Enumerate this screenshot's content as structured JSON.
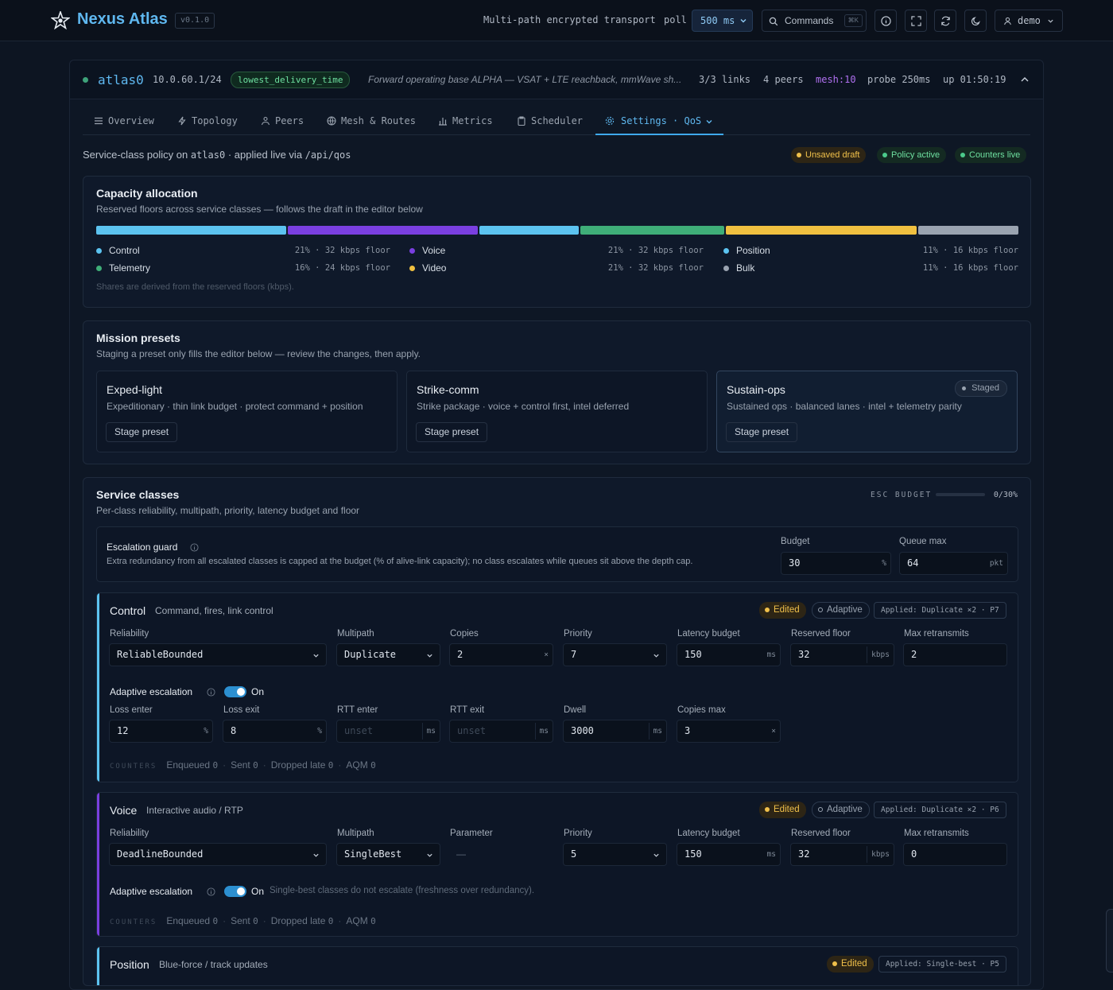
{
  "app": {
    "name": "Nexus Atlas",
    "version": "v0.1.0",
    "tagline": "Multi-path encrypted transport",
    "poll_label": "poll",
    "poll_value": "500 ms",
    "commands_label": "Commands",
    "commands_kbd": "⌘K",
    "user": "demo"
  },
  "iface": {
    "name": "atlas0",
    "address": "10.0.60.1/24",
    "mode": "lowest_delivery_time",
    "description": "Forward operating base ALPHA — VSAT + LTE reachback, mmWave sh...",
    "links": "3/3 links",
    "peers": "4 peers",
    "mesh": "mesh:10",
    "probe": "probe 250ms",
    "uptime": "up 01:50:19"
  },
  "tabs": [
    {
      "label": "Overview"
    },
    {
      "label": "Topology"
    },
    {
      "label": "Peers"
    },
    {
      "label": "Mesh & Routes"
    },
    {
      "label": "Metrics"
    },
    {
      "label": "Scheduler"
    },
    {
      "label": "Settings · QoS"
    }
  ],
  "policy": {
    "prefix": "Service-class policy on",
    "iface": "atlas0",
    "mid": "· applied live via",
    "endpoint": "/api/qos"
  },
  "status_chips": [
    {
      "label": "Unsaved draft",
      "color": "#f0c04a"
    },
    {
      "label": "Policy active",
      "color": "#4bc98a"
    },
    {
      "label": "Counters live",
      "color": "#4bc98a"
    }
  ],
  "capacity": {
    "title": "Capacity allocation",
    "subtitle": "Reserved floors across service classes — follows the draft in the editor below",
    "note": "Shares are derived from the reserved floors (kbps).",
    "classes": [
      {
        "name": "Control",
        "share": 21,
        "value": "21% · 32 kbps floor",
        "color": "#5cc3f0"
      },
      {
        "name": "Voice",
        "share": 21,
        "value": "21% · 32 kbps floor",
        "color": "#7a3fe0"
      },
      {
        "name": "Position",
        "share": 11,
        "value": "11% · 16 kbps floor",
        "color": "#5cc3f0"
      },
      {
        "name": "Telemetry",
        "share": 16,
        "value": "16% · 24 kbps floor",
        "color": "#3fae78"
      },
      {
        "name": "Video",
        "share": 21,
        "value": "21% · 32 kbps floor",
        "color": "#f0c040"
      },
      {
        "name": "Bulk",
        "share": 11,
        "value": "11% · 16 kbps floor",
        "color": "#9aa3b0"
      }
    ]
  },
  "presets": {
    "title": "Mission presets",
    "subtitle": "Staging a preset only fills the editor below — review the changes, then apply.",
    "button_label": "Stage preset",
    "staged_label": "Staged",
    "items": [
      {
        "name": "Exped-light",
        "desc": "Expeditionary · thin link budget · protect command + position"
      },
      {
        "name": "Strike-comm",
        "desc": "Strike package · voice + control first, intel deferred"
      },
      {
        "name": "Sustain-ops",
        "desc": "Sustained ops · balanced lanes · intel + telemetry parity"
      }
    ]
  },
  "service": {
    "title": "Service classes",
    "subtitle": "Per-class reliability, multipath, priority, latency budget and floor",
    "esc_label": "ESC BUDGET",
    "esc_value": "0/30%",
    "esc_fraction": 0,
    "guard": {
      "title": "Escalation guard",
      "desc": "Extra redundancy from all escalated classes is capped at the budget (% of alive-link capacity); no class escalates while queues sit above the depth cap.",
      "budget_label": "Budget",
      "budget": "30",
      "budget_unit": "%",
      "queue_label": "Queue max",
      "queue": "64",
      "queue_unit": "pkt"
    },
    "labels": {
      "reliability": "Reliability",
      "multipath": "Multipath",
      "copies": "Copies",
      "parameter": "Parameter",
      "priority": "Priority",
      "latency": "Latency budget",
      "floor": "Reserved floor",
      "retrans": "Max retransmits",
      "adaptive": "Adaptive escalation",
      "on": "On",
      "loss_enter": "Loss enter",
      "loss_exit": "Loss exit",
      "rtt_enter": "RTT enter",
      "rtt_exit": "RTT exit",
      "dwell": "Dwell",
      "copies_max": "Copies max",
      "counters": "COUNTERS",
      "enqueued": "Enqueued",
      "sent": "Sent",
      "dropped": "Dropped late",
      "aqm": "AQM",
      "edited": "Edited",
      "adaptive_badge": "Adaptive",
      "unset": "unset",
      "dash": "—"
    },
    "units": {
      "pct": "%",
      "ms": "ms",
      "kbps": "kbps",
      "x": "×"
    },
    "classes": [
      {
        "name": "Control",
        "desc": "Command, fires, link control",
        "color": "#5cc3f0",
        "applied": "Applied: Duplicate ×2 · P7",
        "reliability": "ReliableBounded",
        "multipath": "Duplicate",
        "copies": "2",
        "priority": "7",
        "latency": "150",
        "floor": "32",
        "retrans": "2",
        "loss_enter": "12",
        "loss_exit": "8",
        "dwell": "3000",
        "copies_max": "3",
        "enqueued": "0",
        "sent": "0",
        "dropped": "0",
        "aqm": "0"
      },
      {
        "name": "Voice",
        "desc": "Interactive audio / RTP",
        "color": "#7a3fe0",
        "applied": "Applied: Duplicate ×2 · P6",
        "reliability": "DeadlineBounded",
        "multipath": "SingleBest",
        "priority": "5",
        "latency": "150",
        "floor": "32",
        "retrans": "0",
        "note": "Single-best classes do not escalate (freshness over redundancy).",
        "enqueued": "0",
        "sent": "0",
        "dropped": "0",
        "aqm": "0"
      },
      {
        "name": "Position",
        "desc": "Blue-force / track updates",
        "color": "#5cc3f0",
        "applied": "Applied: Single-best · P5"
      }
    ]
  }
}
